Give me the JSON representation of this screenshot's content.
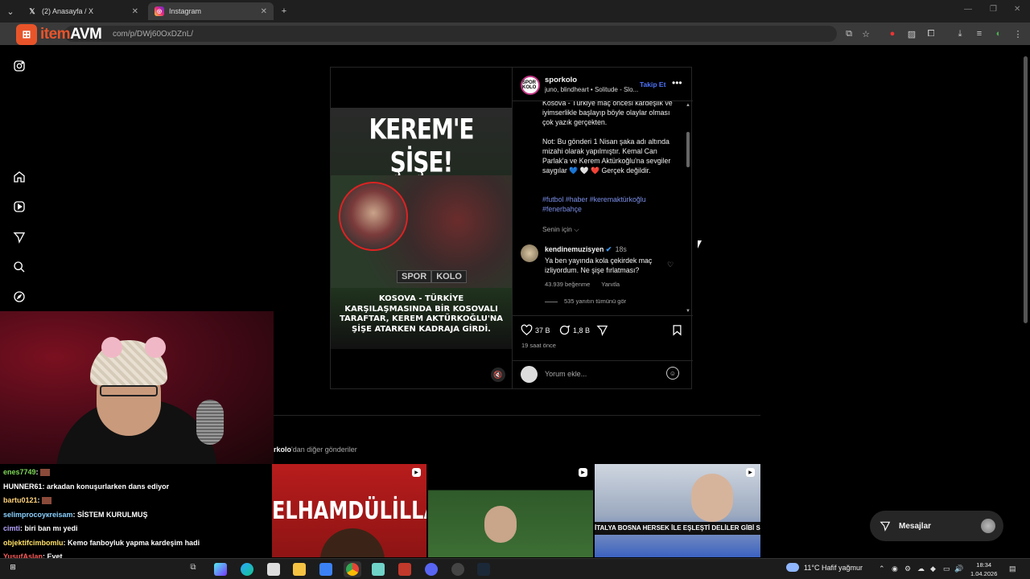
{
  "browser": {
    "tabs": [
      {
        "label": "(2) Anasayfa / X",
        "icon": "x-logo"
      },
      {
        "label": "Instagram",
        "icon": "instagram-logo"
      }
    ],
    "url": "/p/DWj60OxDZnL/",
    "url_domain": "com",
    "new_tab_glyph": "+"
  },
  "watermark": {
    "box": "⊞",
    "item": "item",
    "avm": "AVM"
  },
  "post": {
    "username": "sporkolo",
    "avatar_text": "SPOR KOLO",
    "audio": "juno, blindheart • Solitude - Slo...",
    "follow": "Takip Et",
    "poster_title": "KEREM'E ŞİŞE!",
    "poster_brand_a": "SPOR",
    "poster_brand_b": "KOLO",
    "poster_caption": "KOSOVA - TÜRKİYE KARŞILAŞMASINDA BİR KOSOVALI TARAFTAR, KEREM AKTÜRKOĞLU'NA ŞİŞE ATARKEN KADRAJA GİRDİ.",
    "caption_1": "Kosova - Türkiye maç öncesi kardeşlik ve iyimserlikle başlayıp böyle olaylar olması çok yazık gerçekten.",
    "caption_2": "Not: Bu gönderi 1 Nisan şaka adı altında mizahi olarak yapılmıştır. Kemal Can Parlak'a ve Kerem Aktürkoğlu'na sevgiler saygılar 💙 🤍 ❤️ Gerçek değildir.",
    "hashtags": "#futbol #haber #keremaktürkoğlu #fenerbahçe",
    "for_you": "Senin için ⌵",
    "comment": {
      "user": "kendinemuzisyen",
      "verified": "✔",
      "time": "18s",
      "text": "Ya ben yayında kola çekirdek maç izliyordum. Ne şişe fırlatması?",
      "likes": "43.939 beğenme",
      "reply": "Yanıtla",
      "view_replies": "535 yanıtın tümünü gör"
    },
    "like_count": "37 B",
    "comment_count": "1,8 B",
    "posted_time": "19 saat önce",
    "comment_placeholder": "Yorum ekle..."
  },
  "more_posts": {
    "user_fragment": "rkolo",
    "suffix": "'dan diğer gönderiler",
    "thumb1_text": "ELHAMDÜLİLLAH",
    "thumb3_text": "İTALYA BOSNA HERSEK İLE EŞLEŞTİ DELİLER GİBİ SEVİNDİ"
  },
  "chat": [
    {
      "user": "enes7749",
      "color": "#7ed957",
      "msg": ":"
    },
    {
      "user": "HUNNER61",
      "color": "#ffffff",
      "msg": ": arkadan konuşurlarken dans ediyor"
    },
    {
      "user": "bartu0121",
      "color": "#ffd27a",
      "msg": ":"
    },
    {
      "user": "selimprocoукreisam",
      "color": "#8ad1ff",
      "msg": ": SİSTEM KURULMUŞ"
    },
    {
      "user": "cimti",
      "color": "#b6a4ff",
      "msg": ": biri ban mı yedi"
    },
    {
      "user": "objektifcimbomlu",
      "color": "#ffe066",
      "msg": ": Kemo fanboyluk yapma kardeşim hadi"
    },
    {
      "user": "YusufAslan",
      "color": "#ff5b5b",
      "msg": ": Evet"
    }
  ],
  "mesajlar": "Mesajlar",
  "taskbar": {
    "weather": "11°C  Hafif yağmur",
    "time": "18:34",
    "date": "1.04.2026"
  }
}
